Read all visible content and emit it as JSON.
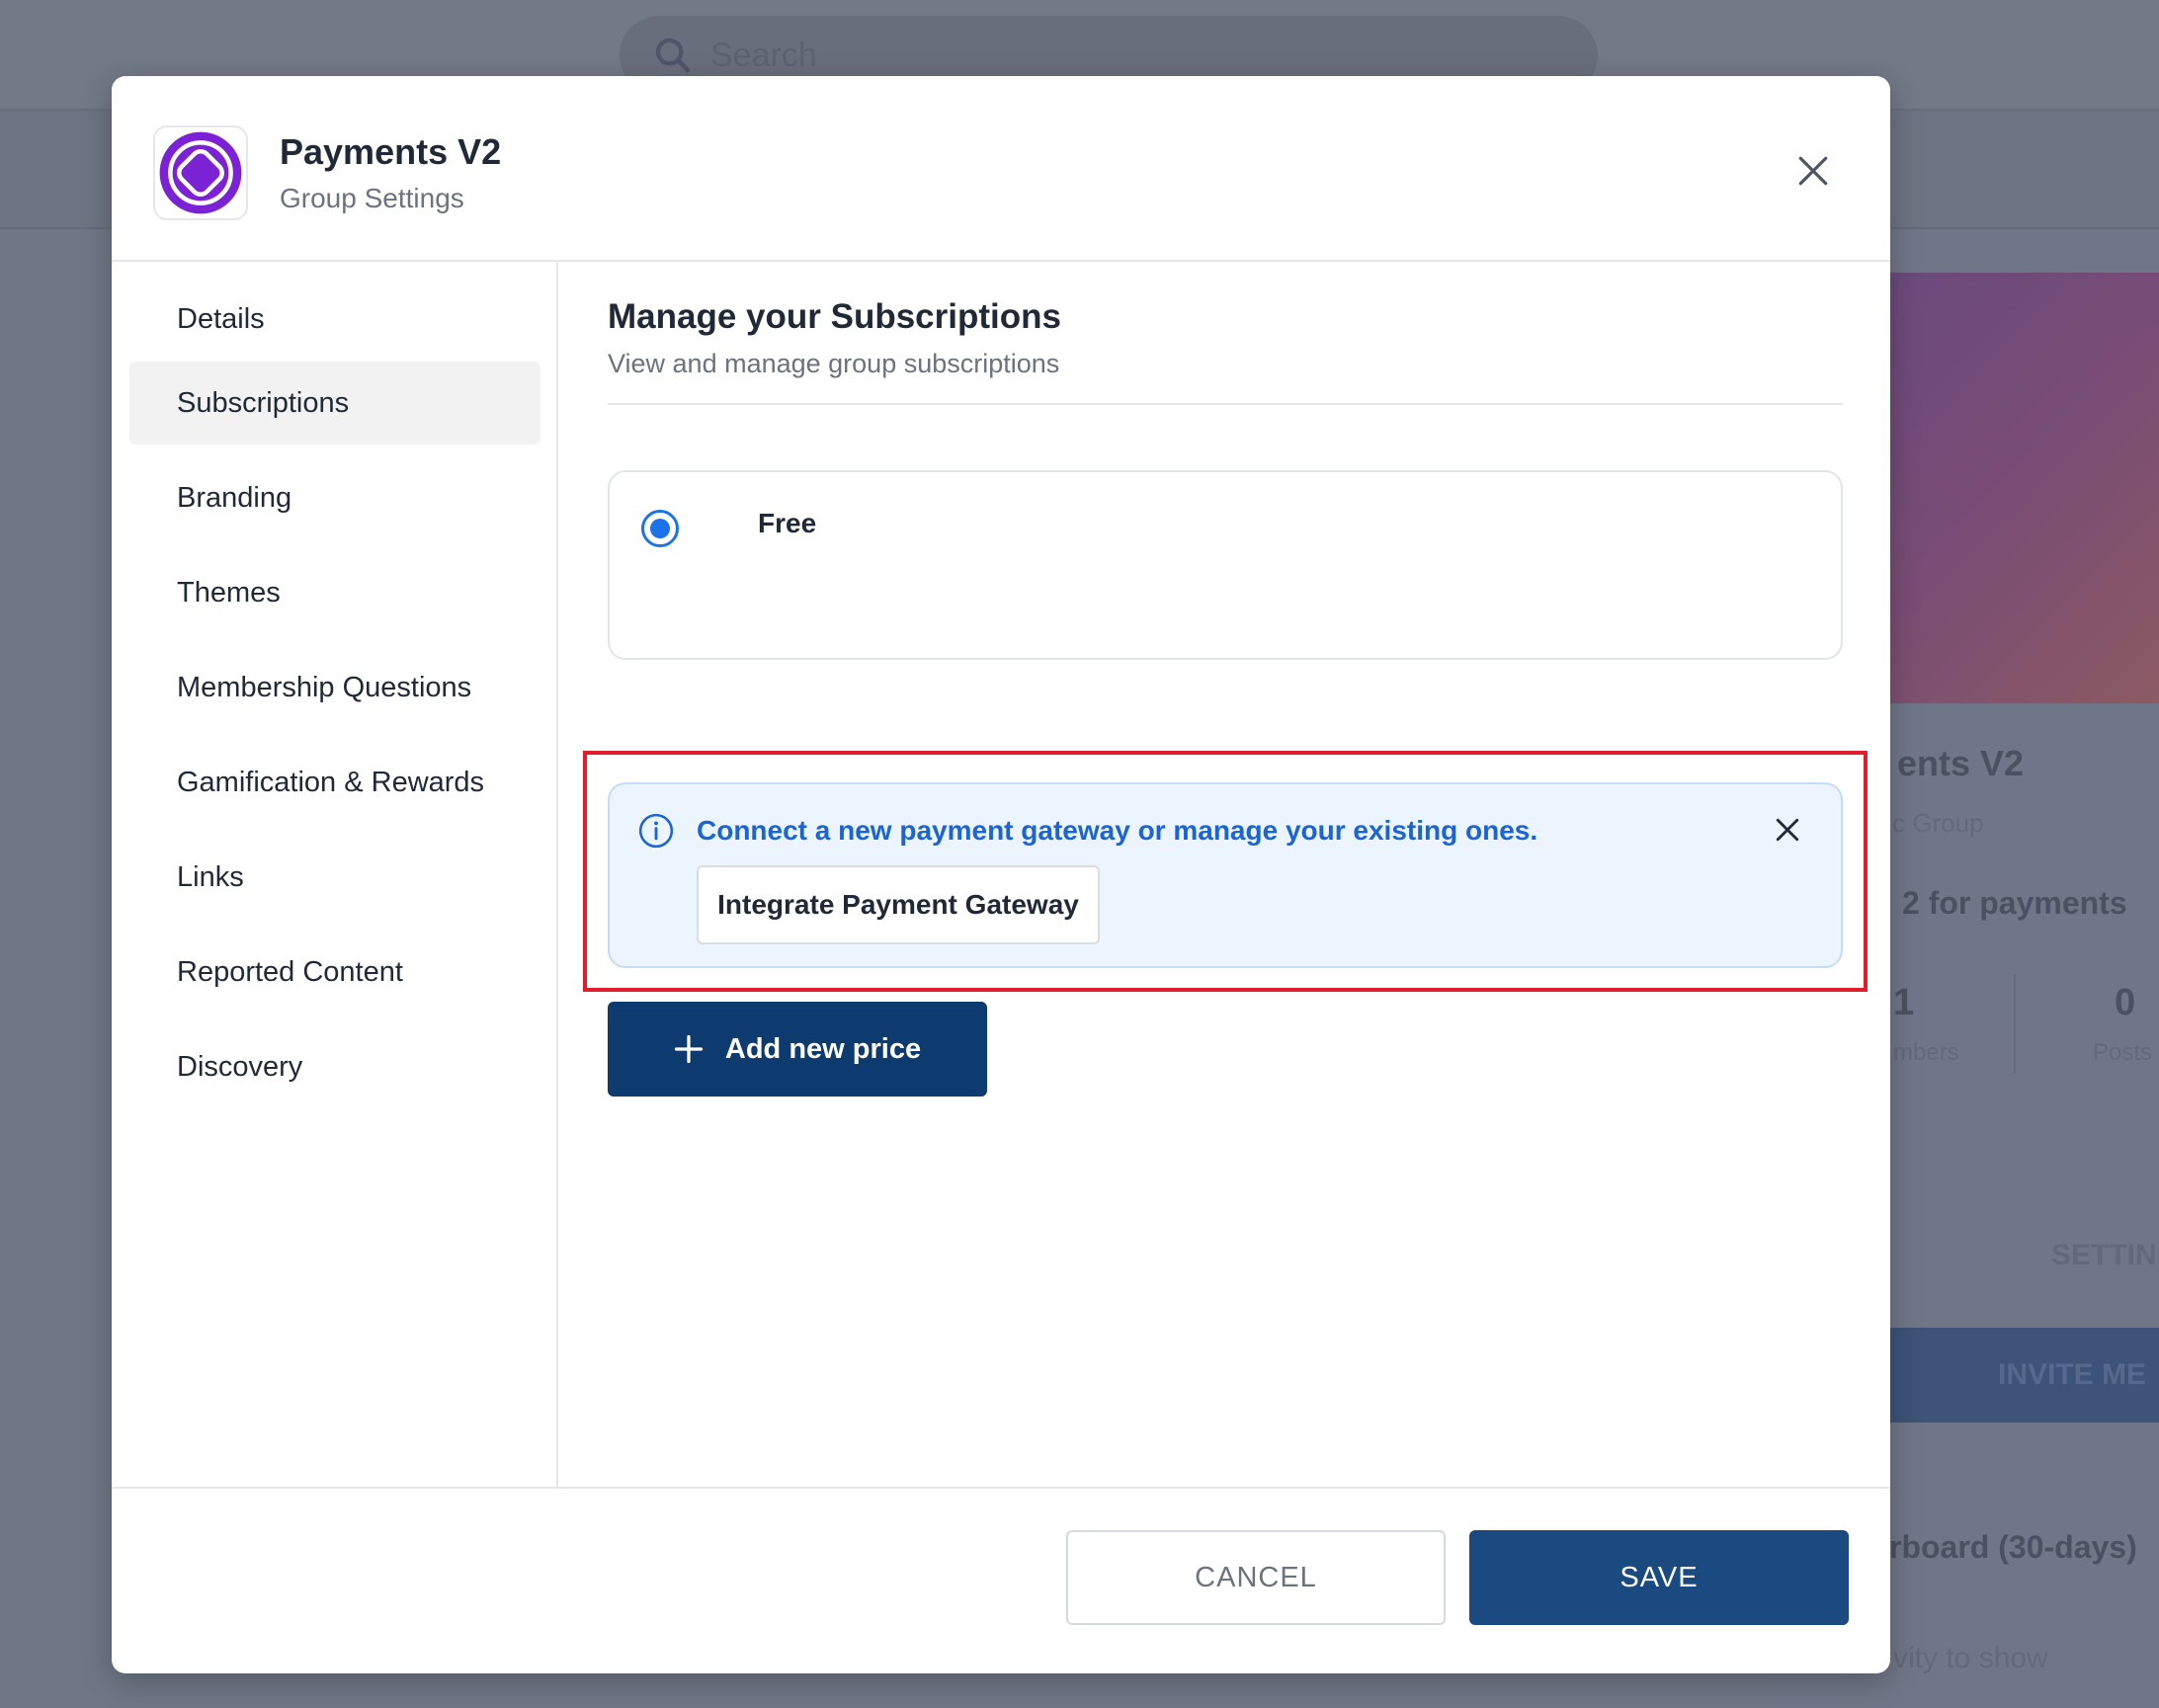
{
  "background": {
    "search": {
      "placeholder": "Search"
    },
    "group_title_partial": "ents V2",
    "group_type_partial": "c Group",
    "payments_note_partial": "2 for payments",
    "stats": [
      {
        "value": "1",
        "label_partial": "mbers"
      },
      {
        "value": "0",
        "label_partial": "Posts"
      }
    ],
    "settings_partial": "SETTIN",
    "invite_partial": "INVITE ME",
    "leaderboard_partial": "rboard (30-days)",
    "activity_partial": "vity to show"
  },
  "modal": {
    "header": {
      "title": "Payments V2",
      "subtitle": "Group Settings",
      "logo_icon": "group-logo-icon",
      "close_icon": "close-icon"
    },
    "sidebar": {
      "items": [
        {
          "label": "Details",
          "active": false
        },
        {
          "label": "Subscriptions",
          "active": true
        },
        {
          "label": "Branding",
          "active": false
        },
        {
          "label": "Themes",
          "active": false
        },
        {
          "label": "Membership Questions",
          "active": false
        },
        {
          "label": "Gamification & Rewards",
          "active": false
        },
        {
          "label": "Links",
          "active": false
        },
        {
          "label": "Reported Content",
          "active": false
        },
        {
          "label": "Discovery",
          "active": false
        }
      ]
    },
    "content": {
      "title": "Manage your Subscriptions",
      "subtitle": "View and manage group subscriptions",
      "plans": [
        {
          "name": "Free",
          "selected": true
        }
      ],
      "alert": {
        "message": "Connect a new payment gateway or manage your existing ones.",
        "button_label": "Integrate Payment Gateway",
        "icon": "info-icon",
        "color": "#1a64d6"
      },
      "add_price_label": "Add new price"
    },
    "footer": {
      "cancel_label": "CANCEL",
      "save_label": "SAVE"
    },
    "colors": {
      "primary": "#0e3b6f",
      "save": "#1b4a80",
      "highlight": "#e11d2a",
      "radio": "#1a73e8"
    }
  }
}
